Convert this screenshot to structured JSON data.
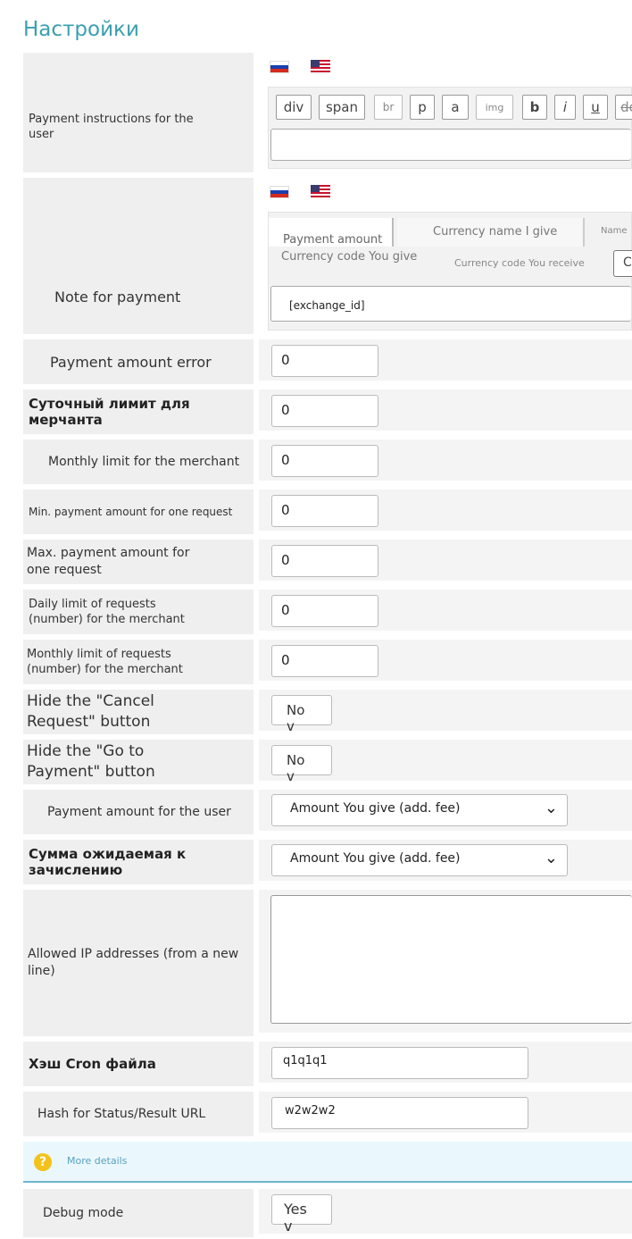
{
  "page_title": "Настройки",
  "flags": [
    "ru-flag-icon",
    "us-flag-icon"
  ],
  "instructions": {
    "label": "Payment instructions for the user",
    "tags": [
      "div",
      "span",
      "br",
      "p",
      "a",
      "img",
      "b",
      "i",
      "u",
      "de"
    ]
  },
  "note": {
    "label": "Note for payment",
    "tags_top": [
      "Payment amount",
      "Currency name I give",
      "Name"
    ],
    "tags_bottom": [
      "Currency code You give",
      "Currency code You receive",
      "C"
    ],
    "value": "[exchange_id]"
  },
  "fields": [
    {
      "label": "Payment amount error",
      "value": "0"
    },
    {
      "label": "Суточный лимит для мерчанта",
      "value": "0"
    },
    {
      "label": "Monthly limit for the merchant",
      "value": "0"
    },
    {
      "label": "Min. payment amount for one request",
      "value": "0"
    },
    {
      "label": "Max. payment amount for one request",
      "value": "0"
    },
    {
      "label": "Daily limit of requests (number) for the merchant",
      "value": "0"
    },
    {
      "label": "Monthly limit of requests (number) for the merchant",
      "value": "0"
    }
  ],
  "hide_cancel": {
    "label": "Hide the \"Cancel Request\" button",
    "value": "No v"
  },
  "hide_goto": {
    "label": "Hide the \"Go to Payment\" button",
    "value": "No v"
  },
  "pay_amount_user": {
    "label": "Payment amount for the user",
    "value": "Amount You give (add. fee)"
  },
  "expected_sum": {
    "label": "Сумма ожидаемая к зачислению",
    "value": "Amount You give (add. fee)"
  },
  "allowed_ip": {
    "label": "Allowed IP addresses (from a new line)",
    "value": ""
  },
  "cron_hash": {
    "label": "Хэш Cron файла",
    "value": "q1q1q1"
  },
  "status_hash": {
    "label": "Hash for Status/Result URL",
    "value": "w2w2w2"
  },
  "help": {
    "text": "More details",
    "icon": "question-icon"
  },
  "debug": {
    "label": "Debug mode",
    "value": "Yes v"
  }
}
